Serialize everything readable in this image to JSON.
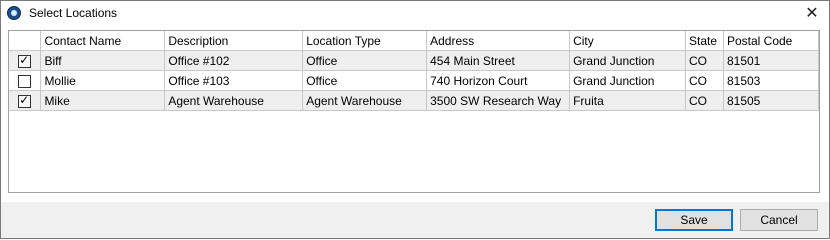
{
  "window": {
    "title": "Select Locations",
    "close_label": "✕"
  },
  "grid": {
    "columns": [
      "",
      "Contact Name",
      "Description",
      "Location Type",
      "Address",
      "City",
      "State",
      "Postal Code"
    ],
    "rows": [
      {
        "checked": true,
        "contact": "Biff",
        "description": "Office #102",
        "type": "Office",
        "address": "454 Main Street",
        "city": "Grand Junction",
        "state": "CO",
        "postal": "81501"
      },
      {
        "checked": false,
        "contact": "Mollie",
        "description": "Office #103",
        "type": "Office",
        "address": "740 Horizon Court",
        "city": "Grand Junction",
        "state": "CO",
        "postal": "81503"
      },
      {
        "checked": true,
        "contact": "Mike",
        "description": "Agent Warehouse",
        "type": "Agent Warehouse",
        "address": "3500 SW Research Way",
        "city": "Fruita",
        "state": "CO",
        "postal": "81505"
      }
    ]
  },
  "footer": {
    "save_label": "Save",
    "cancel_label": "Cancel"
  }
}
